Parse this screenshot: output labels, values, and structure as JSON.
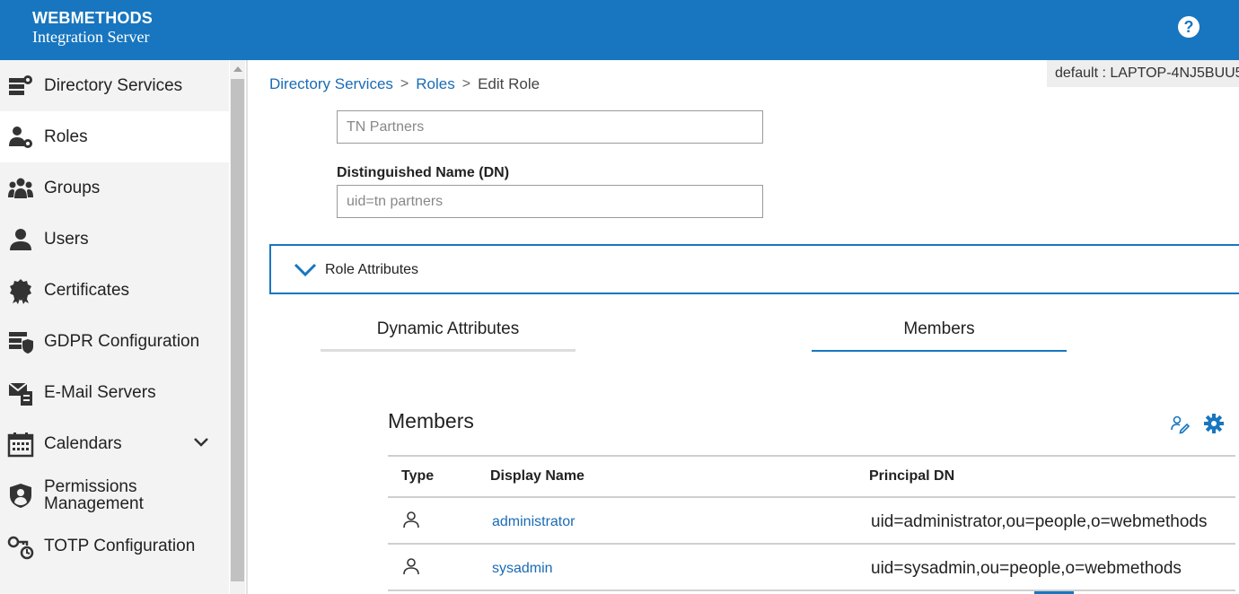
{
  "header": {
    "brand_title": "WEBMETHODS",
    "brand_subtitle": "Integration Server",
    "help_label": "?"
  },
  "sidebar": {
    "items": [
      {
        "label": "Directory Services",
        "icon": "directory-services-icon"
      },
      {
        "label": "Roles",
        "icon": "roles-icon",
        "active": true
      },
      {
        "label": "Groups",
        "icon": "groups-icon"
      },
      {
        "label": "Users",
        "icon": "users-icon"
      },
      {
        "label": "Certificates",
        "icon": "certificate-icon"
      },
      {
        "label": "GDPR Configuration",
        "icon": "gdpr-icon"
      },
      {
        "label": "E-Mail Servers",
        "icon": "email-servers-icon"
      },
      {
        "label": "Calendars",
        "icon": "calendar-icon",
        "expandable": true
      },
      {
        "label": "Permissions Management",
        "label_line1": "Permissions",
        "label_line2": "Management",
        "icon": "shield-user-icon"
      },
      {
        "label": "TOTP Configuration",
        "icon": "totp-key-icon"
      }
    ]
  },
  "breadcrumb": {
    "items": [
      "Directory Services",
      "Roles",
      "Edit Role"
    ],
    "separator": ">"
  },
  "server_tag": "default : LAPTOP-4NJ5BUU5",
  "form": {
    "role_name_value": "TN Partners",
    "dn_label": "Distinguished Name (DN)",
    "dn_value": "uid=tn partners"
  },
  "accordion": {
    "label": "Role Attributes",
    "expanded": true
  },
  "tabs": [
    {
      "label": "Dynamic Attributes",
      "selected": false
    },
    {
      "label": "Members",
      "selected": true
    }
  ],
  "members": {
    "title": "Members",
    "columns": [
      "Type",
      "Display Name",
      "Principal DN"
    ],
    "rows": [
      {
        "type_icon": "user-icon",
        "display_name": "administrator",
        "principal_dn": "uid=administrator,ou=people,o=webmethods"
      },
      {
        "type_icon": "user-icon",
        "display_name": "sysadmin",
        "principal_dn": "uid=sysadmin,ou=people,o=webmethods"
      }
    ]
  },
  "colors": {
    "brand_blue": "#1776bf",
    "link_blue": "#1a6bb5",
    "sidebar_bg": "#f3f3f3"
  }
}
